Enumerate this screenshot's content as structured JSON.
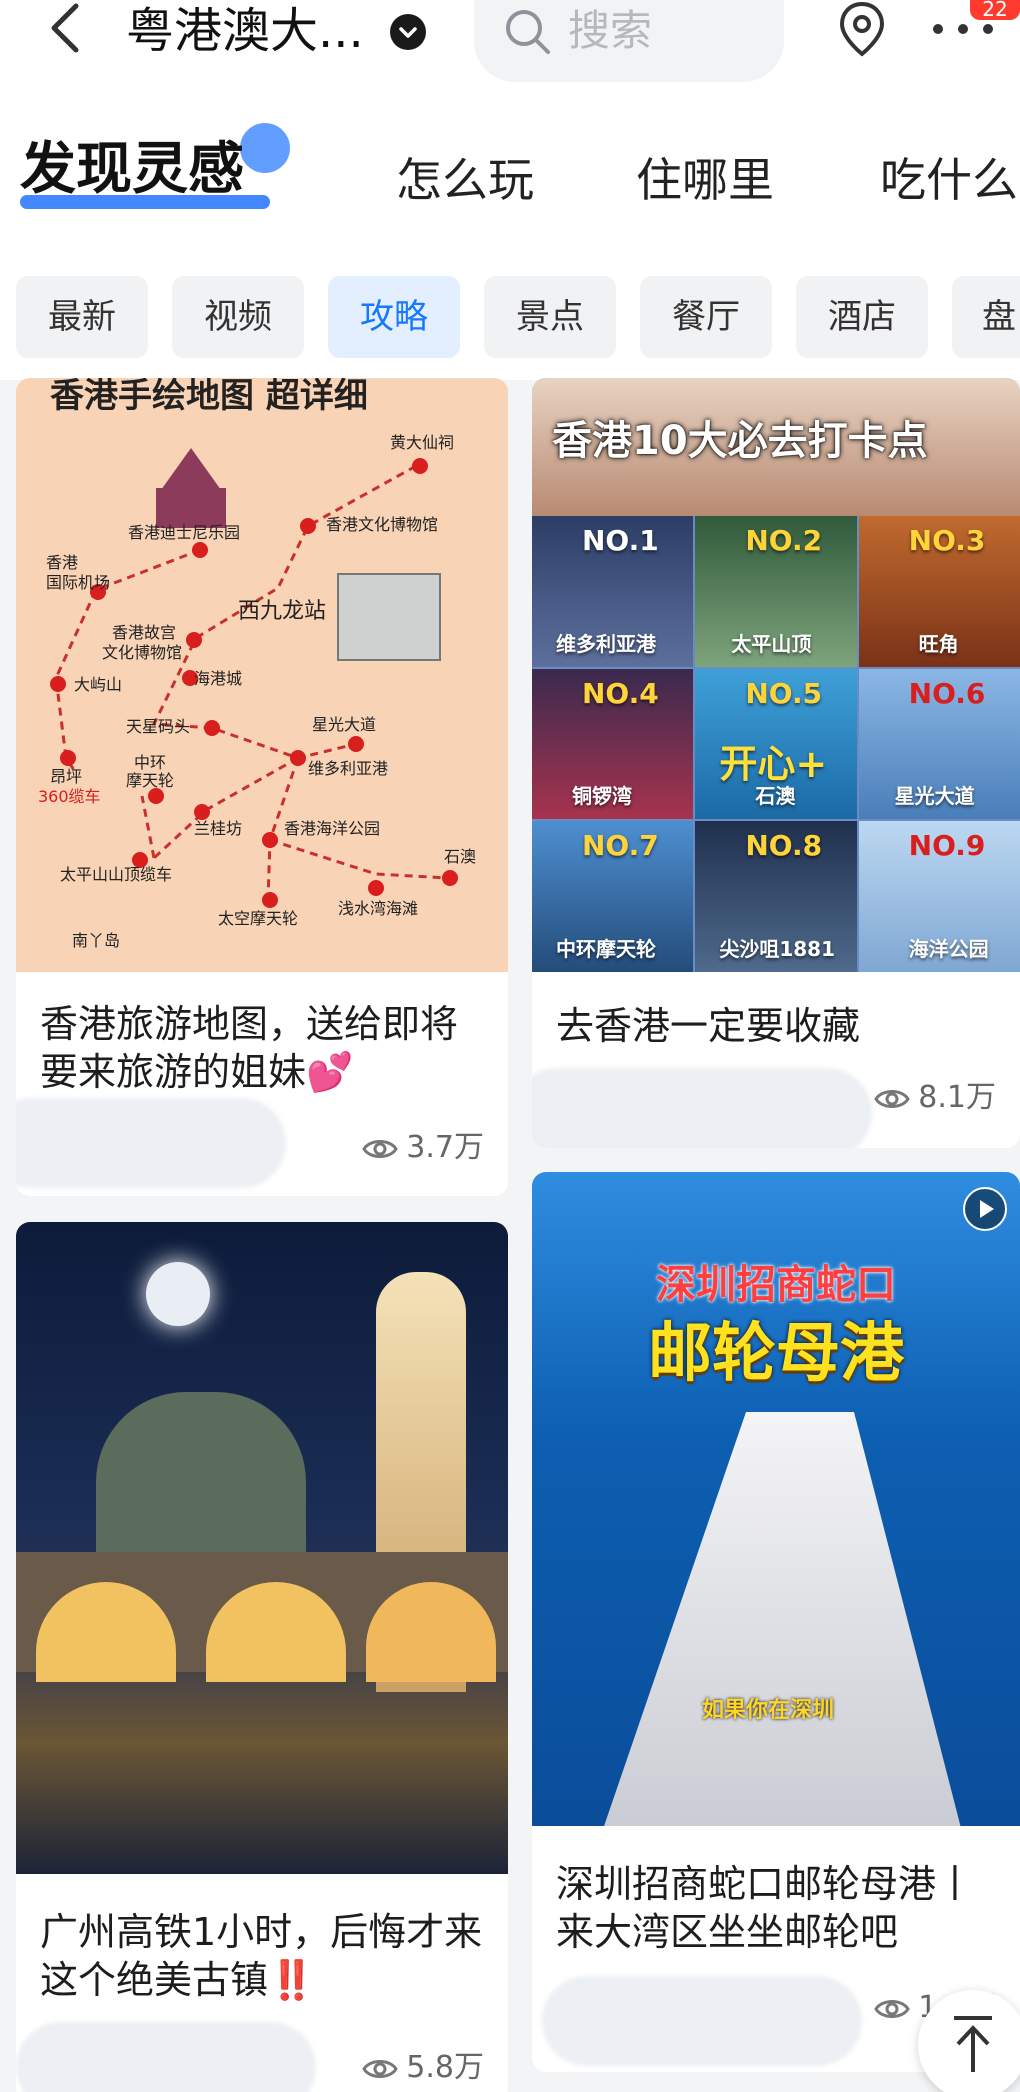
{
  "header": {
    "city": "粤港澳大...",
    "search_placeholder": "搜索",
    "badge": "22"
  },
  "tabs": {
    "active": "发现灵感",
    "items": [
      "怎么玩",
      "住哪里",
      "吃什么"
    ]
  },
  "chips": [
    "最新",
    "视频",
    "攻略",
    "景点",
    "餐厅",
    "酒店",
    "盘"
  ],
  "active_chip": "攻略",
  "cards": [
    {
      "title": "香港旅游地图，送给即将要来旅游的姐妹💕",
      "views": "3.7万",
      "image_title": "香港手绘地图 超详细",
      "map_points": [
        "黄大仙祠",
        "香港迪士尼乐园",
        "香港文化博物馆",
        "香港国际机场",
        "西九龙站",
        "香港故宫文化博物馆",
        "海港城",
        "大屿山",
        "天星码头",
        "星光大道",
        "中环摩天轮",
        "维多利亚港",
        "昂坪360缆车",
        "兰桂坊",
        "香港海洋公园",
        "石澳",
        "太平山山顶缆车",
        "太空摩天轮",
        "浅水湾海滩",
        "南丫岛"
      ]
    },
    {
      "title": "去香港一定要收藏",
      "views": "8.1万",
      "image_title": "香港10大必去打卡点",
      "spots": [
        {
          "no": "NO.1",
          "name": "维多利亚港"
        },
        {
          "no": "NO.2",
          "name": "太平山顶"
        },
        {
          "no": "NO.3",
          "name": "旺角"
        },
        {
          "no": "NO.4",
          "name": "铜锣湾"
        },
        {
          "no": "NO.5",
          "name": "石澳"
        },
        {
          "no": "NO.6",
          "name": "星光大道"
        },
        {
          "no": "NO.7",
          "name": "中环摩天轮"
        },
        {
          "no": "NO.8",
          "name": "尖沙咀1881"
        },
        {
          "no": "NO.9",
          "name": "海洋公园"
        }
      ],
      "sticker": "开心+"
    },
    {
      "title": "广州高铁1小时，后悔才来这个绝美古镇‼️",
      "views": "5.8万"
    },
    {
      "title": "深圳招商蛇口邮轮母港丨来大湾区坐坐邮轮吧",
      "views": "1.3万",
      "image_title_1": "深圳招商蛇口",
      "image_title_2": "邮轮母港",
      "image_caption": "如果你在深圳"
    }
  ]
}
